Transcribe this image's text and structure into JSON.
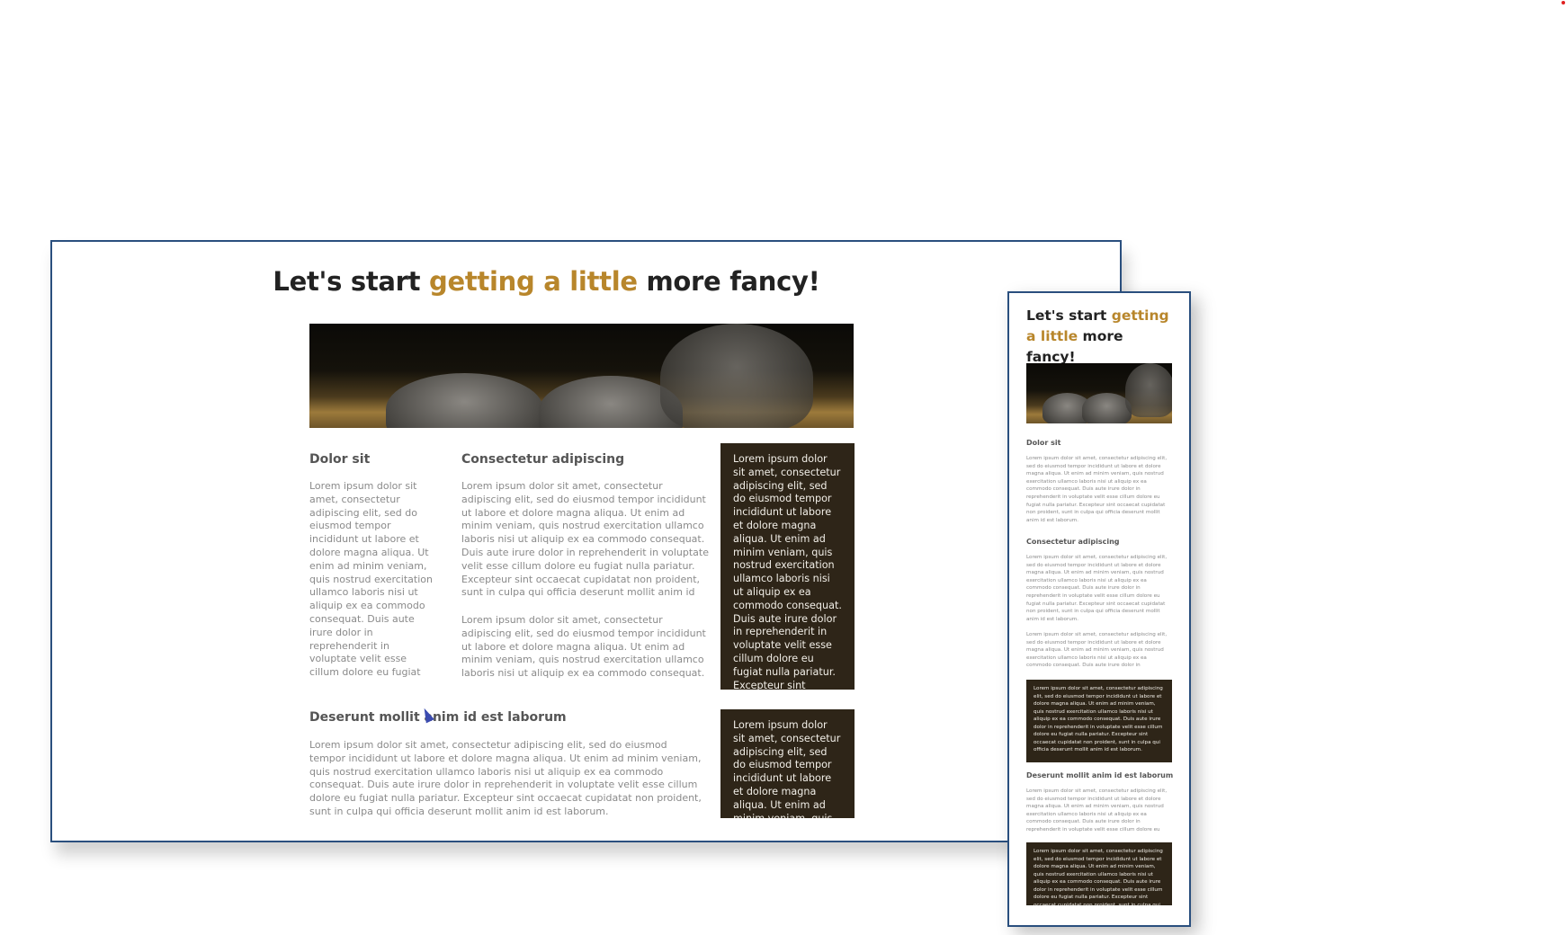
{
  "title": {
    "before": "Let's start ",
    "highlight": "getting a little",
    "after": " more fancy!",
    "highlight_a": "getting a",
    "highlight_b": "little"
  },
  "colors": {
    "accent": "#b8862b",
    "dark_box": "#2e2518",
    "frame_border": "#2a4f7e"
  },
  "headings": {
    "dolor": "Dolor sit",
    "consectetur": "Consectetur adipiscing",
    "deserunt": "Deserunt mollit anim id est laborum"
  },
  "lorem": {
    "full": "Lorem ipsum dolor sit amet, consectetur adipiscing elit, sed do eiusmod tempor incididunt ut labore et dolore magna aliqua. Ut enim ad minim veniam, quis nostrud exercitation ullamco laboris nisi ut aliquip ex ea commodo consequat. Duis aute irure dolor in reprehenderit in voluptate velit esse cillum dolore eu fugiat nulla pariatur. Excepteur sint occaecat cupidatat non proident, sunt in culpa qui officia deserunt mollit anim id est laborum.",
    "short": "Lorem ipsum dolor sit amet, consectetur adipiscing elit, sed do eiusmod tempor incididunt ut labore et dolore magna aliqua. Ut enim ad minim veniam, quis nostrud exercitation ullamco laboris nisi ut aliquip ex ea commodo consequat. Duis aute irure dolor in"
  }
}
